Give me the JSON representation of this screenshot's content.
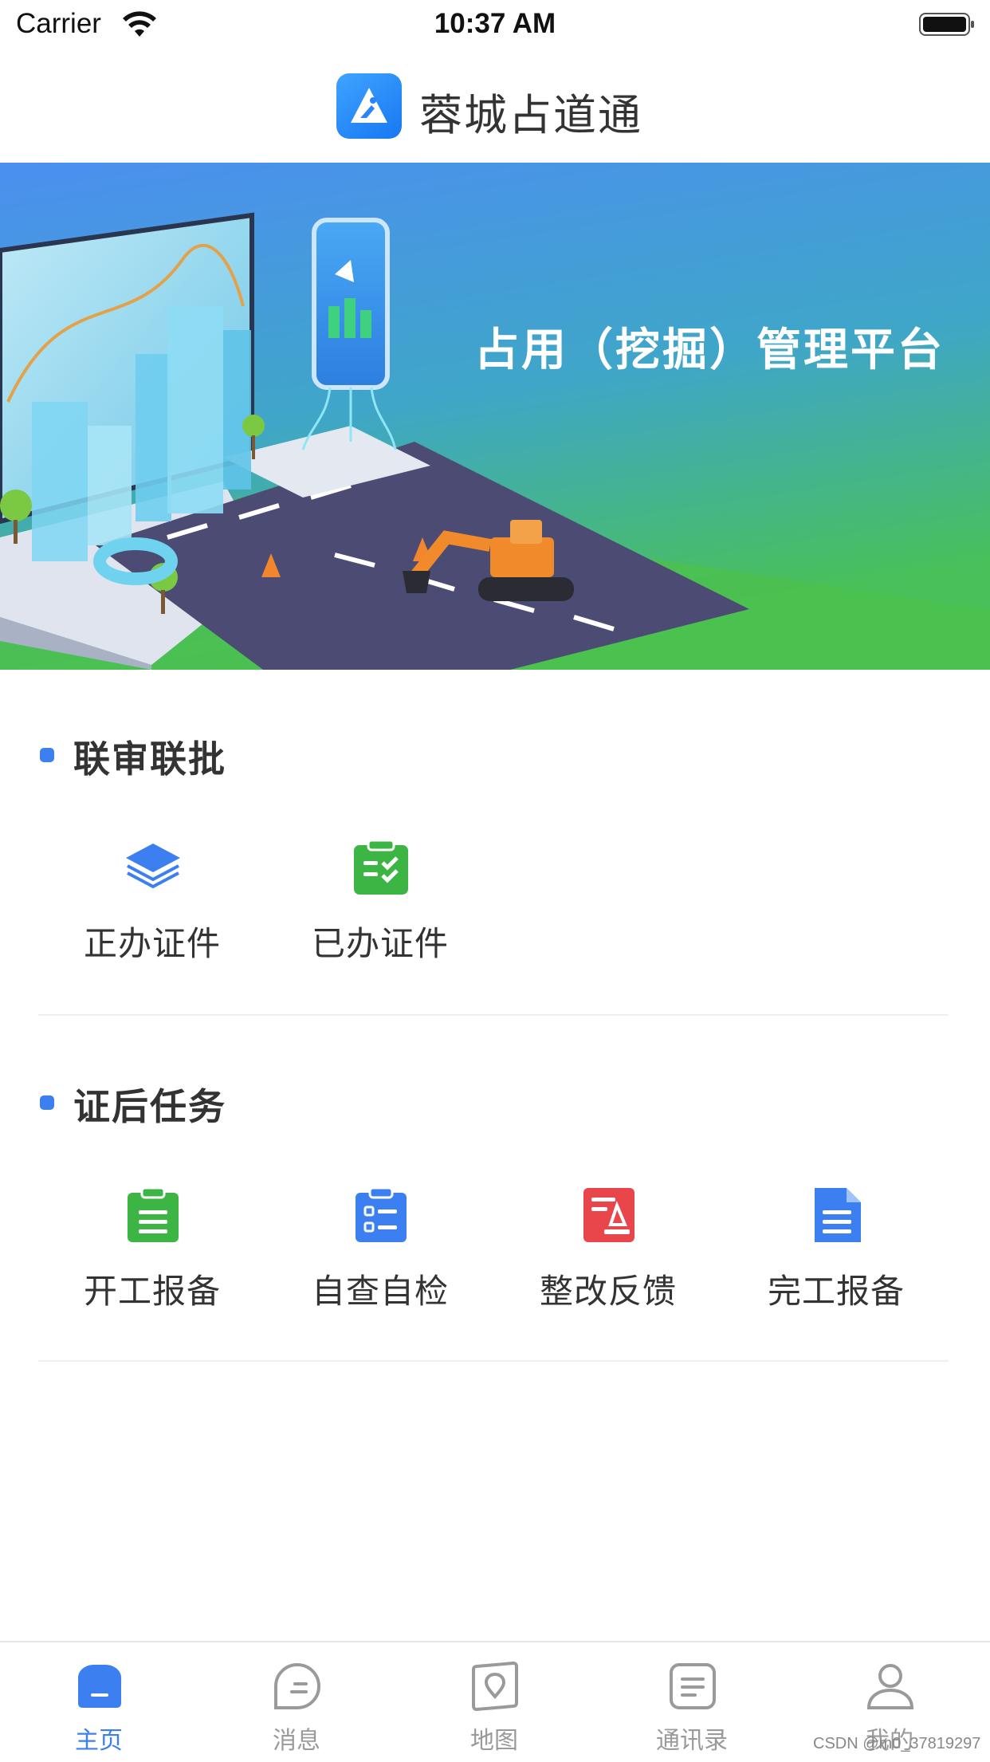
{
  "status_bar": {
    "carrier": "Carrier",
    "time": "10:37 AM"
  },
  "header": {
    "app_title": "蓉城占道通"
  },
  "banner": {
    "title": "占用（挖掘）管理平台"
  },
  "sections": [
    {
      "title": "联审联批",
      "items": [
        {
          "label": "正办证件",
          "icon": "layers-icon",
          "color": "#3b7ff0"
        },
        {
          "label": "已办证件",
          "icon": "clipboard-check-icon",
          "color": "#3cb545"
        }
      ]
    },
    {
      "title": "证后任务",
      "items": [
        {
          "label": "开工报备",
          "icon": "clipboard-list-icon",
          "color": "#3cb545"
        },
        {
          "label": "自查自检",
          "icon": "checklist-icon",
          "color": "#3b7ff0"
        },
        {
          "label": "整改反馈",
          "icon": "feedback-doc-icon",
          "color": "#e9464c"
        },
        {
          "label": "完工报备",
          "icon": "document-icon",
          "color": "#3b7ff0"
        }
      ]
    }
  ],
  "tab_bar": {
    "active_color": "#3b7ff0",
    "inactive_color": "#9a9a9a",
    "tabs": [
      {
        "label": "主页",
        "icon": "home-icon",
        "active": true
      },
      {
        "label": "消息",
        "icon": "message-icon",
        "active": false
      },
      {
        "label": "地图",
        "icon": "map-icon",
        "active": false
      },
      {
        "label": "通讯录",
        "icon": "contacts-icon",
        "active": false
      },
      {
        "label": "我的",
        "icon": "profile-icon",
        "active": false
      }
    ]
  },
  "watermark": "CSDN @m0_37819297"
}
